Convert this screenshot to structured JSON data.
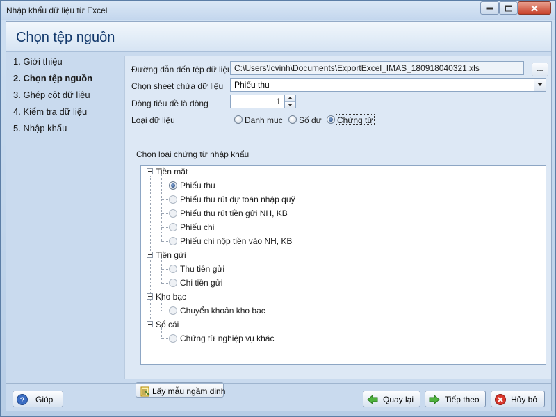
{
  "window": {
    "title": "Nhập khẩu dữ liệu từ Excel"
  },
  "header": {
    "title": "Chọn tệp nguồn"
  },
  "steps": [
    {
      "label": "1. Giới thiệu"
    },
    {
      "label": "2. Chọn tệp nguồn",
      "active": true
    },
    {
      "label": "3. Ghép cột dữ liệu"
    },
    {
      "label": "4. Kiểm tra dữ liệu"
    },
    {
      "label": "5. Nhập khẩu"
    }
  ],
  "form": {
    "path_label": "Đường dẫn đến tệp dữ liệu",
    "path_value": "C:\\Users\\lcvinh\\Documents\\ExportExcel_IMAS_180918040321.xls",
    "browse_label": "...",
    "sheet_label": "Chọn sheet chứa dữ liệu",
    "sheet_value": "Phiếu thu",
    "header_row_label": "Dòng tiêu đề là dòng",
    "header_row_value": "1",
    "data_type_label": "Loại dữ liệu",
    "data_types": [
      {
        "label": "Danh mục",
        "checked": false
      },
      {
        "label": "Số dư",
        "checked": false
      },
      {
        "label": "Chứng từ",
        "checked": true
      }
    ],
    "voucher_type_label": "Chọn loại chứng từ nhập khẩu"
  },
  "tree": {
    "groups": [
      {
        "label": "Tiền mặt",
        "items": [
          {
            "label": "Phiếu thu",
            "checked": true
          },
          {
            "label": "Phiếu thu rút dự toán nhập quỹ"
          },
          {
            "label": "Phiếu thu rút tiền gửi NH, KB"
          },
          {
            "label": "Phiếu chi"
          },
          {
            "label": "Phiếu chi nộp tiền vào NH, KB"
          }
        ]
      },
      {
        "label": "Tiền gửi",
        "items": [
          {
            "label": "Thu tiền gửi"
          },
          {
            "label": "Chi tiền gửi"
          }
        ]
      },
      {
        "label": "Kho bạc",
        "items": [
          {
            "label": "Chuyển khoản kho bạc"
          }
        ]
      },
      {
        "label": "Sổ cái",
        "items": [
          {
            "label": "Chứng từ nghiệp vụ khác"
          }
        ]
      }
    ]
  },
  "buttons": {
    "default_template": "Lấy mẫu ngầm định",
    "help": "Giúp",
    "back": "Quay lại",
    "next": "Tiếp theo",
    "cancel": "Hủy bỏ"
  },
  "colors": {
    "accent": "#12386b",
    "window_bg": "#c9daee",
    "panel_bg": "#dde8f5"
  }
}
